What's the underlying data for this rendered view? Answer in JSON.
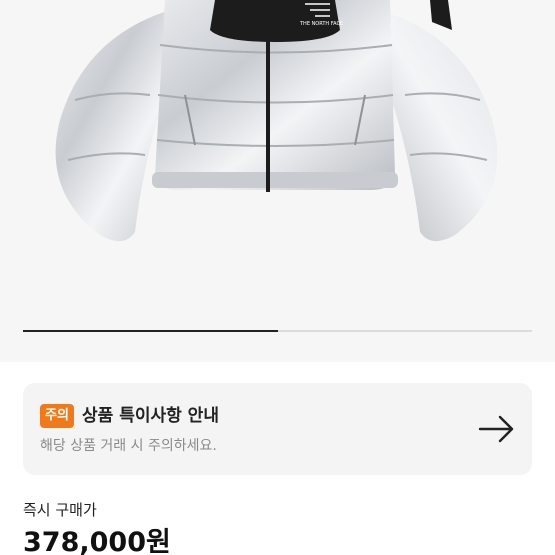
{
  "product": {
    "image_alt": "The North Face silver puffer jacket",
    "brand_logo_text": "THE NORTH FACE"
  },
  "carousel": {
    "progress": 0.5
  },
  "notice": {
    "badge": "주의",
    "title": "상품 특이사항 안내",
    "subtitle": "해당 상품 거래 시 주의하세요.",
    "icon": "arrow-right-icon",
    "badge_color": "#f07a1a"
  },
  "purchase": {
    "label": "즉시 구매가",
    "price": "378,000원"
  }
}
